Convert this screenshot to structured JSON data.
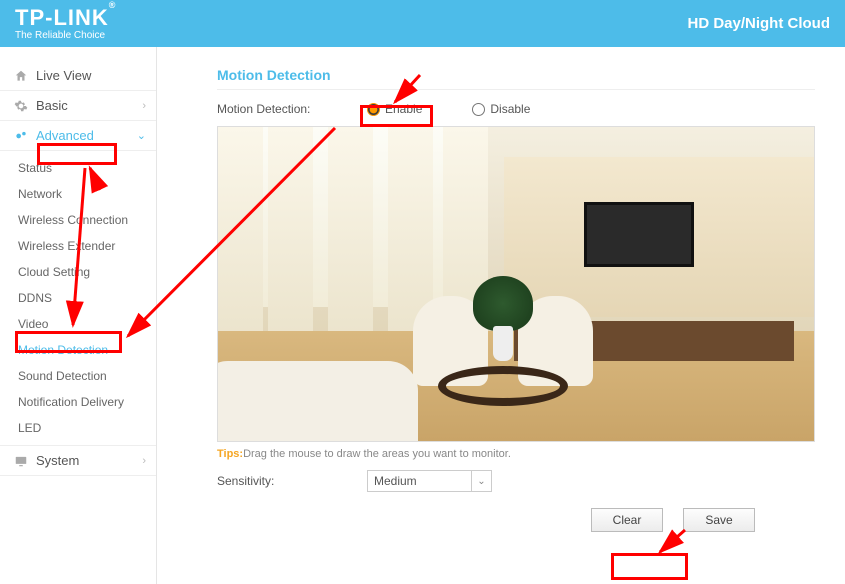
{
  "header": {
    "logo_main": "TP-LINK",
    "logo_sub": "The Reliable Choice",
    "title": "HD Day/Night Cloud"
  },
  "sidebar": {
    "live_view": "Live View",
    "basic": "Basic",
    "advanced": "Advanced",
    "submenu": {
      "status": "Status",
      "network": "Network",
      "wireless_connection": "Wireless Connection",
      "wireless_extender": "Wireless Extender",
      "cloud_setting": "Cloud Setting",
      "ddns": "DDNS",
      "video": "Video",
      "motion_detection": "Motion Detection",
      "sound_detection": "Sound Detection",
      "notification_delivery": "Notification Delivery",
      "led": "LED"
    },
    "system": "System"
  },
  "content": {
    "page_title": "Motion Detection",
    "md_label": "Motion Detection:",
    "enable": "Enable",
    "disable": "Disable",
    "tips_label": "Tips:",
    "tips_text": "Drag the mouse to draw the areas you want to monitor.",
    "sensitivity_label": "Sensitivity:",
    "sensitivity_value": "Medium",
    "clear": "Clear",
    "save": "Save"
  }
}
